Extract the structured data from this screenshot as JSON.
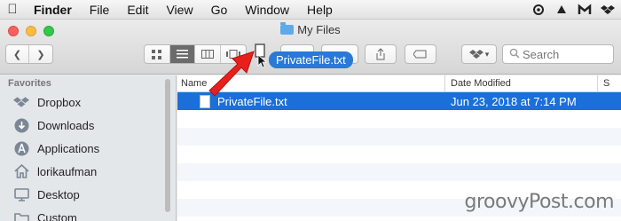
{
  "menubar": {
    "app_name": "Finder",
    "items": [
      "File",
      "Edit",
      "View",
      "Go",
      "Window",
      "Help"
    ]
  },
  "window": {
    "title": "My Files"
  },
  "search": {
    "placeholder": "Search"
  },
  "sidebar": {
    "section": "Favorites",
    "items": [
      {
        "label": "Dropbox",
        "icon": "dropbox-icon"
      },
      {
        "label": "Downloads",
        "icon": "download-icon"
      },
      {
        "label": "Applications",
        "icon": "applications-icon"
      },
      {
        "label": "lorikaufman",
        "icon": "home-icon"
      },
      {
        "label": "Desktop",
        "icon": "desktop-icon"
      },
      {
        "label": "Custom",
        "icon": "folder-icon"
      }
    ]
  },
  "list": {
    "headers": {
      "name": "Name",
      "date": "Date Modified",
      "size": "S"
    },
    "rows": [
      {
        "name": "PrivateFile.txt",
        "date": "Jun 23, 2018 at 7:14 PM",
        "selected": true
      }
    ]
  },
  "drag": {
    "label": "PrivateFile.txt"
  },
  "watermark": "groovyPost.com",
  "colors": {
    "selection": "#1a6fd9",
    "arrow": "#e8201c"
  }
}
